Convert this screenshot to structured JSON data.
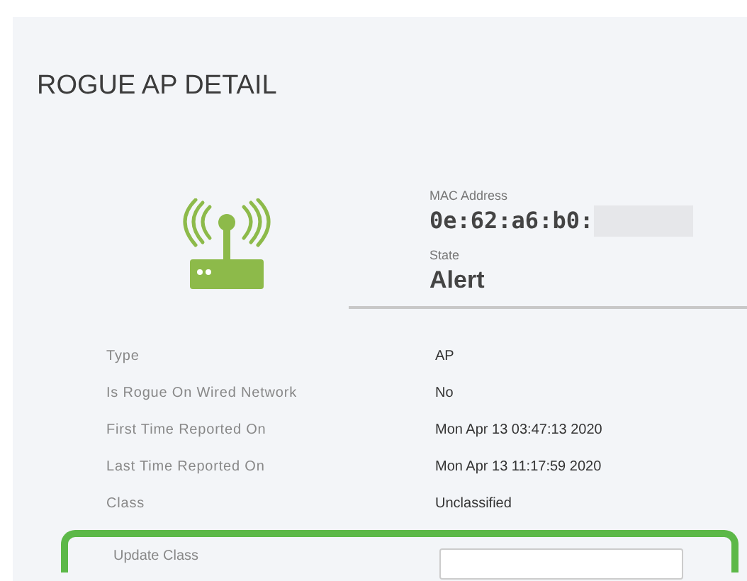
{
  "panel": {
    "title": "ROGUE AP DETAIL"
  },
  "summary": {
    "mac_label": "MAC Address",
    "mac_value": "0e:62:a6:b0:",
    "state_label": "State",
    "state_value": "Alert"
  },
  "details": [
    {
      "label": "Type",
      "value": "AP"
    },
    {
      "label": "Is Rogue On Wired Network",
      "value": "No"
    },
    {
      "label": "First Time Reported On",
      "value": "Mon Apr 13 03:47:13 2020"
    },
    {
      "label": "Last Time Reported On",
      "value": "Mon Apr 13 11:17:59 2020"
    },
    {
      "label": "Class",
      "value": "Unclassified"
    }
  ],
  "update_class": {
    "label": "Update Class",
    "highlighted": true
  }
}
